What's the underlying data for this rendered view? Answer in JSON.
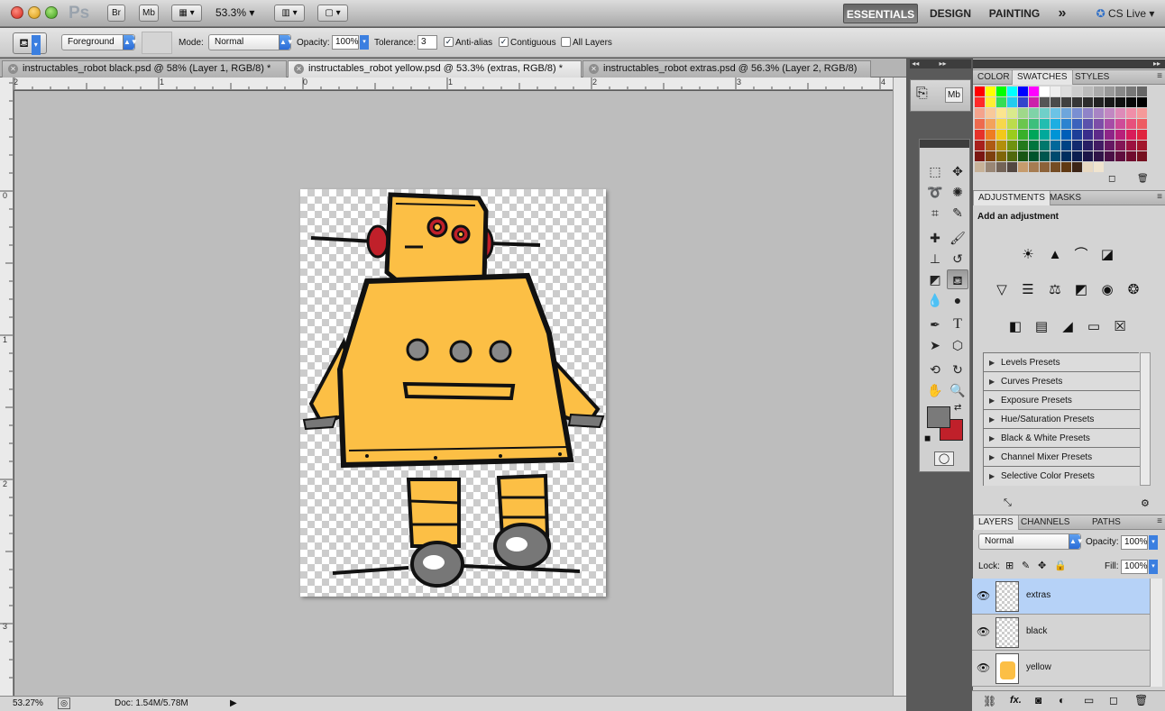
{
  "appbar": {
    "ps_logo": "Ps",
    "bridge": "Br",
    "minibridge": "Mb",
    "zoom": "53.3%",
    "workspaces": [
      "ESSENTIALS",
      "DESIGN",
      "PAINTING"
    ],
    "more": "»",
    "cs_live": "CS Live"
  },
  "options": {
    "fill_source": "Foreground",
    "mode_label": "Mode:",
    "mode_value": "Normal",
    "opacity_label": "Opacity:",
    "opacity_value": "100%",
    "tolerance_label": "Tolerance:",
    "tolerance_value": "3",
    "antialias_label": "Anti-alias",
    "contiguous_label": "Contiguous",
    "all_layers_label": "All Layers"
  },
  "tabs": [
    {
      "label": "instructables_robot black.psd @ 58% (Layer 1, RGB/8) *"
    },
    {
      "label": "instructables_robot yellow.psd @ 53.3% (extras, RGB/8) *"
    },
    {
      "label": "instructables_robot extras.psd @ 56.3% (Layer 2, RGB/8)"
    }
  ],
  "ruler": {
    "h": [
      "2",
      "1",
      "0",
      "1",
      "2",
      "3",
      "4"
    ],
    "v": [
      "0",
      "1",
      "2",
      "3"
    ]
  },
  "status": {
    "zoom": "53.27%",
    "doc": "Doc: 1.54M/5.78M"
  },
  "swatches_panel": {
    "tabs": [
      "COLOR",
      "SWATCHES",
      "STYLES"
    ]
  },
  "adjustments_panel": {
    "tabs": [
      "ADJUSTMENTS",
      "MASKS"
    ],
    "heading": "Add an adjustment",
    "presets": [
      "Levels Presets",
      "Curves Presets",
      "Exposure Presets",
      "Hue/Saturation Presets",
      "Black & White Presets",
      "Channel Mixer Presets",
      "Selective Color Presets"
    ]
  },
  "layers_panel": {
    "tabs": [
      "LAYERS",
      "CHANNELS",
      "PATHS"
    ],
    "blend_mode": "Normal",
    "opacity_label": "Opacity:",
    "opacity_value": "100%",
    "lock_label": "Lock:",
    "fill_label": "Fill:",
    "fill_value": "100%",
    "layers": [
      {
        "name": "extras",
        "selected": true
      },
      {
        "name": "black",
        "selected": false
      },
      {
        "name": "yellow",
        "selected": false
      }
    ]
  },
  "colors": {
    "foreground": "#7a7a7a",
    "background": "#c0202a",
    "robot_yellow": "#fcbf45",
    "robot_red": "#c0202a"
  }
}
